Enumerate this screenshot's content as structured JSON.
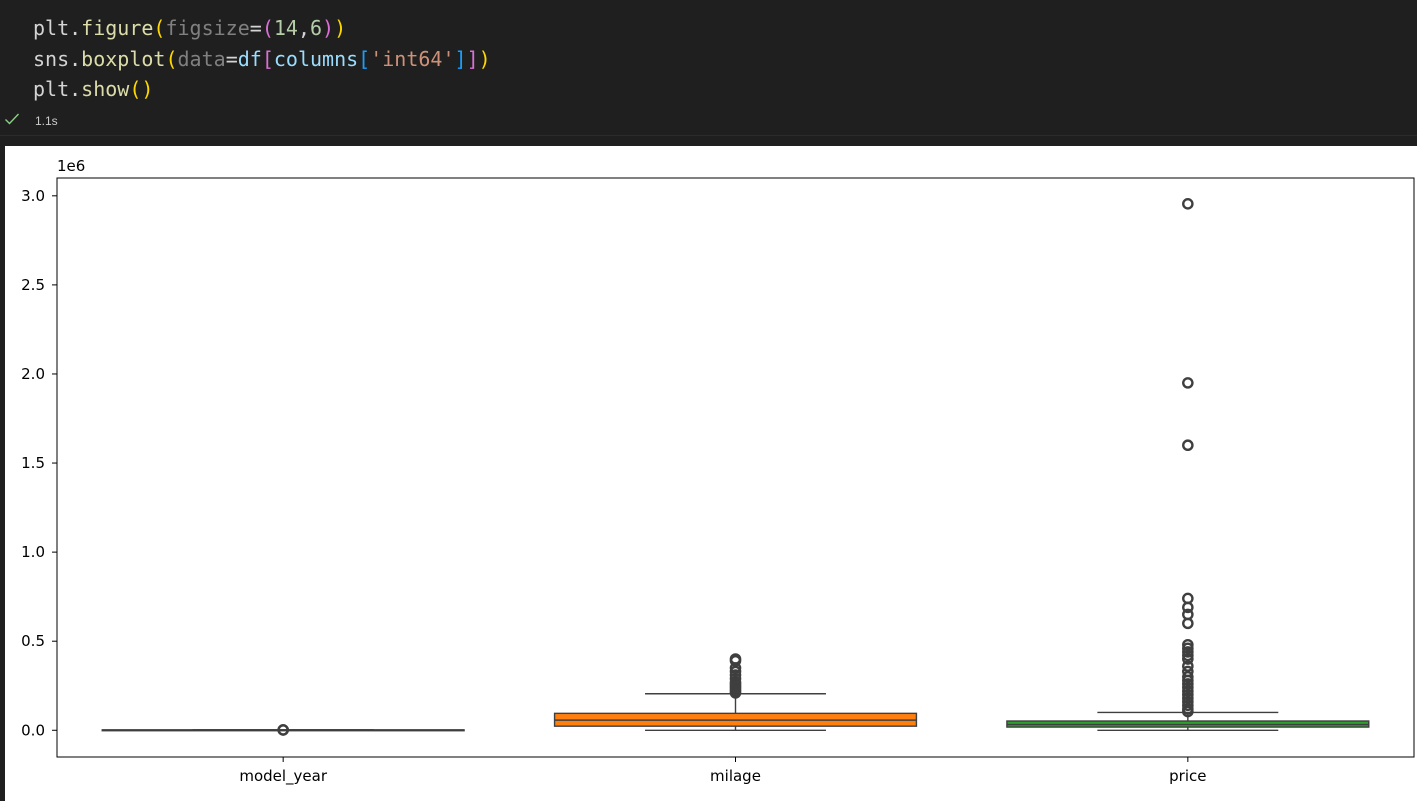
{
  "code": {
    "line1": [
      {
        "t": "plt",
        "c": "tk-var"
      },
      {
        "t": ".",
        "c": "tk-var"
      },
      {
        "t": "figure",
        "c": "tk-fn"
      },
      {
        "t": "(",
        "c": "tk-p1"
      },
      {
        "t": "figsize",
        "c": "tk-pale"
      },
      {
        "t": "=",
        "c": "tk-var"
      },
      {
        "t": "(",
        "c": "tk-p2"
      },
      {
        "t": "14",
        "c": "tk-num"
      },
      {
        "t": ",",
        "c": "tk-var"
      },
      {
        "t": "6",
        "c": "tk-num"
      },
      {
        "t": ")",
        "c": "tk-p2"
      },
      {
        "t": ")",
        "c": "tk-p1"
      }
    ],
    "line2": [
      {
        "t": "sns",
        "c": "tk-var"
      },
      {
        "t": ".",
        "c": "tk-var"
      },
      {
        "t": "boxplot",
        "c": "tk-fn"
      },
      {
        "t": "(",
        "c": "tk-p1"
      },
      {
        "t": "data",
        "c": "tk-pale"
      },
      {
        "t": "=",
        "c": "tk-var"
      },
      {
        "t": "df",
        "c": "tk-kw"
      },
      {
        "t": "[",
        "c": "tk-p2"
      },
      {
        "t": "columns",
        "c": "tk-kw"
      },
      {
        "t": "[",
        "c": "tk-p3"
      },
      {
        "t": "'int64'",
        "c": "tk-str"
      },
      {
        "t": "]",
        "c": "tk-p3"
      },
      {
        "t": "]",
        "c": "tk-p2"
      },
      {
        "t": ")",
        "c": "tk-p1"
      }
    ],
    "line3": [
      {
        "t": "plt",
        "c": "tk-var"
      },
      {
        "t": ".",
        "c": "tk-var"
      },
      {
        "t": "show",
        "c": "tk-fn"
      },
      {
        "t": "()",
        "c": "tk-p1"
      }
    ]
  },
  "status": {
    "icon": "check-icon",
    "time": "1.1s",
    "color": "#89d185"
  },
  "chart_data": {
    "type": "box",
    "offset_label": "1e6",
    "categories": [
      "model_year",
      "milage",
      "price"
    ],
    "colors": [
      "#1f77b4",
      "#ff7f0e",
      "#2ca02c"
    ],
    "yticks": [
      "0.0",
      "0.5",
      "1.0",
      "1.5",
      "2.0",
      "2.5",
      "3.0"
    ],
    "ylim": [
      -0.15,
      3.1
    ],
    "units": "millions",
    "boxes": [
      {
        "whisker_low": 0.00197,
        "q1": 0.00201,
        "median": 0.00203,
        "q3": 0.00204,
        "whisker_high": 0.00205,
        "outliers": [
          0.00195,
          0.0018
        ]
      },
      {
        "whisker_low": 0.0,
        "q1": 0.023,
        "median": 0.057,
        "q3": 0.095,
        "whisker_high": 0.205,
        "outliers": [
          0.21,
          0.22,
          0.23,
          0.24,
          0.25,
          0.26,
          0.27,
          0.29,
          0.31,
          0.33,
          0.35,
          0.39,
          0.4
        ]
      },
      {
        "whisker_low": 0.0,
        "q1": 0.018,
        "median": 0.032,
        "q3": 0.052,
        "whisker_high": 0.1,
        "outliers": [
          0.105,
          0.12,
          0.14,
          0.16,
          0.18,
          0.2,
          0.22,
          0.24,
          0.26,
          0.28,
          0.3,
          0.33,
          0.36,
          0.4,
          0.42,
          0.44,
          0.46,
          0.48,
          0.6,
          0.65,
          0.69,
          0.74,
          1.6,
          1.95,
          2.955
        ]
      }
    ]
  }
}
